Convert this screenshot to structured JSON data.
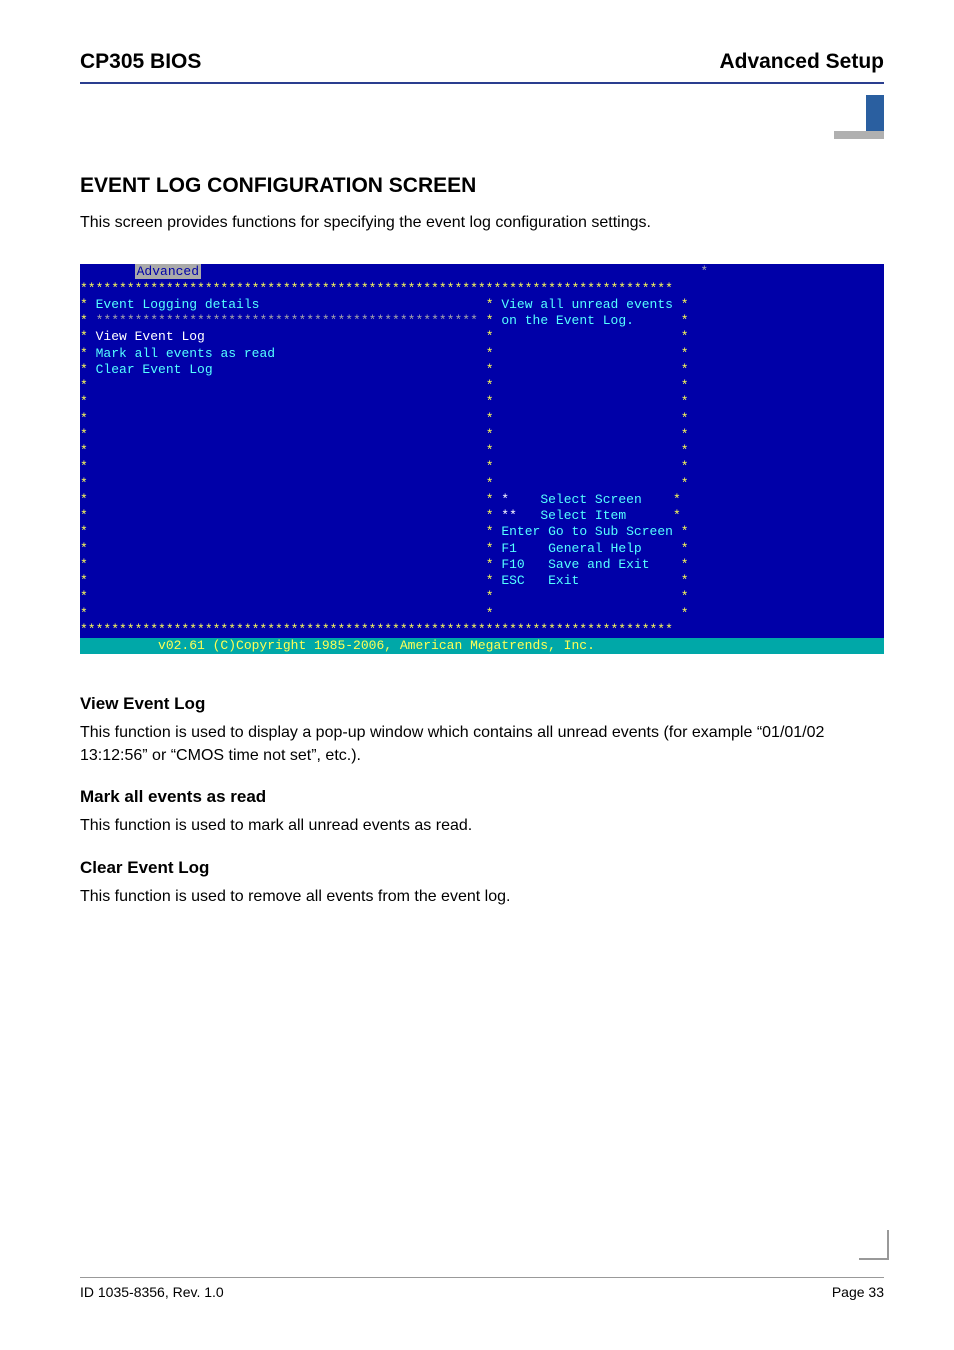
{
  "header": {
    "left": "CP305 BIOS",
    "right": "Advanced Setup"
  },
  "section_title": "EVENT LOG CONFIGURATION SCREEN",
  "intro": "This screen provides functions for specifying the event log configuration settings.",
  "bios": {
    "tab_active": "Advanced",
    "section_header": "Event Logging details",
    "menu_items": {
      "view": "View Event Log",
      "mark": "Mark all events as read",
      "clear": "Clear Event Log"
    },
    "help_text": {
      "line1": "View all unread events",
      "line2": "on the Event Log."
    },
    "nav": {
      "select_screen": "Select Screen",
      "select_item": "Select Item",
      "enter": "Enter Go to Sub Screen",
      "f1": "F1    General Help",
      "f10": "F10   Save and Exit",
      "esc": "ESC   Exit"
    },
    "footer": "v02.61 (C)Copyright 1985-2006, American Megatrends, Inc."
  },
  "sub": {
    "view_title": "View Event Log",
    "view_body": "This function is used to display a pop-up window which contains all unread events (for example “01/01/02 13:12:56” or “CMOS time not set”, etc.).",
    "mark_title": "Mark all events as read",
    "mark_body": "This function is used to mark all unread events as read.",
    "clear_title": "Clear Event Log",
    "clear_body": "This function is used to remove all events from the event log."
  },
  "footer": {
    "left": "ID 1035-8356, Rev. 1.0",
    "right": "Page 33"
  }
}
